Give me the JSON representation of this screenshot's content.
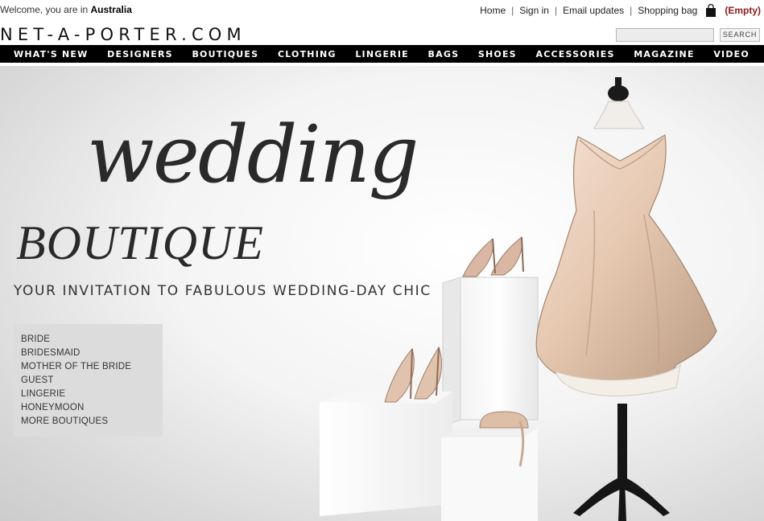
{
  "topbar": {
    "welcome_prefix": "Welcome, you are in",
    "country": "Australia",
    "links": [
      "Home",
      "Sign in",
      "Email updates",
      "Shopping bag"
    ],
    "bag_status": "(Empty)",
    "separator": "|"
  },
  "header": {
    "logo": "NET-A-PORTER.COM",
    "search_button": "SEARCH",
    "search_placeholder": ""
  },
  "nav": {
    "items": [
      "WHAT'S NEW",
      "DESIGNERS",
      "BOUTIQUES",
      "CLOTHING",
      "LINGERIE",
      "BAGS",
      "SHOES",
      "ACCESSORIES",
      "MAGAZINE",
      "VIDEO"
    ]
  },
  "hero": {
    "title_script": "wedding",
    "title_caps": "BOUTIQUE",
    "tagline": "YOUR INVITATION TO FABULOUS WEDDING-DAY CHIC",
    "menu": [
      "BRIDE",
      "BRIDESMAID",
      "MOTHER OF THE BRIDE",
      "GUEST",
      "LINGERIE",
      "HONEYMOON",
      "MORE BOUTIQUES"
    ]
  },
  "colors": {
    "nav_bg": "#000000",
    "bag_status": "#8b1a1a",
    "menu_box": "#dcdcdc",
    "dress": "#e8cdb8"
  }
}
